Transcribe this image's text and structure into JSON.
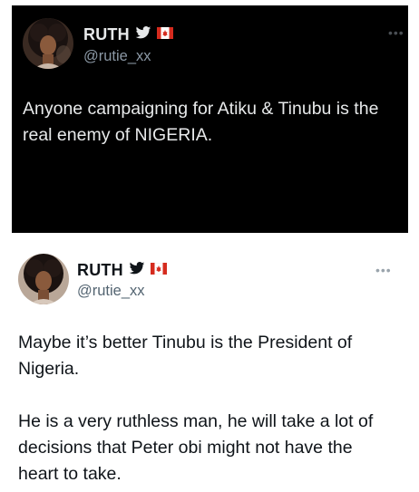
{
  "tweets": [
    {
      "theme": "dark",
      "display_name": "RUTH",
      "handle": "@rutie_xx",
      "body": [
        "Anyone campaigning for Atiku & Tinubu is the",
        "real enemy of NIGERIA."
      ],
      "icons": [
        "twitter-bird-icon",
        "canada-flag-icon"
      ],
      "menu_icon": "more-options-icon"
    },
    {
      "theme": "light",
      "display_name": "RUTH",
      "handle": "@rutie_xx",
      "body": [
        "Maybe it’s better Tinubu is the President of",
        "Nigeria.",
        "",
        "He is a very ruthless man, he will take a lot of",
        "decisions that Peter obi might not have the",
        "heart to take."
      ],
      "icons": [
        "twitter-bird-icon",
        "canada-flag-icon"
      ],
      "menu_icon": "more-options-icon"
    }
  ],
  "colors": {
    "dark_bg": "#000000",
    "light_bg": "#ffffff",
    "bird_blue": "#1d9bf0",
    "flag_red": "#d52b1e"
  }
}
